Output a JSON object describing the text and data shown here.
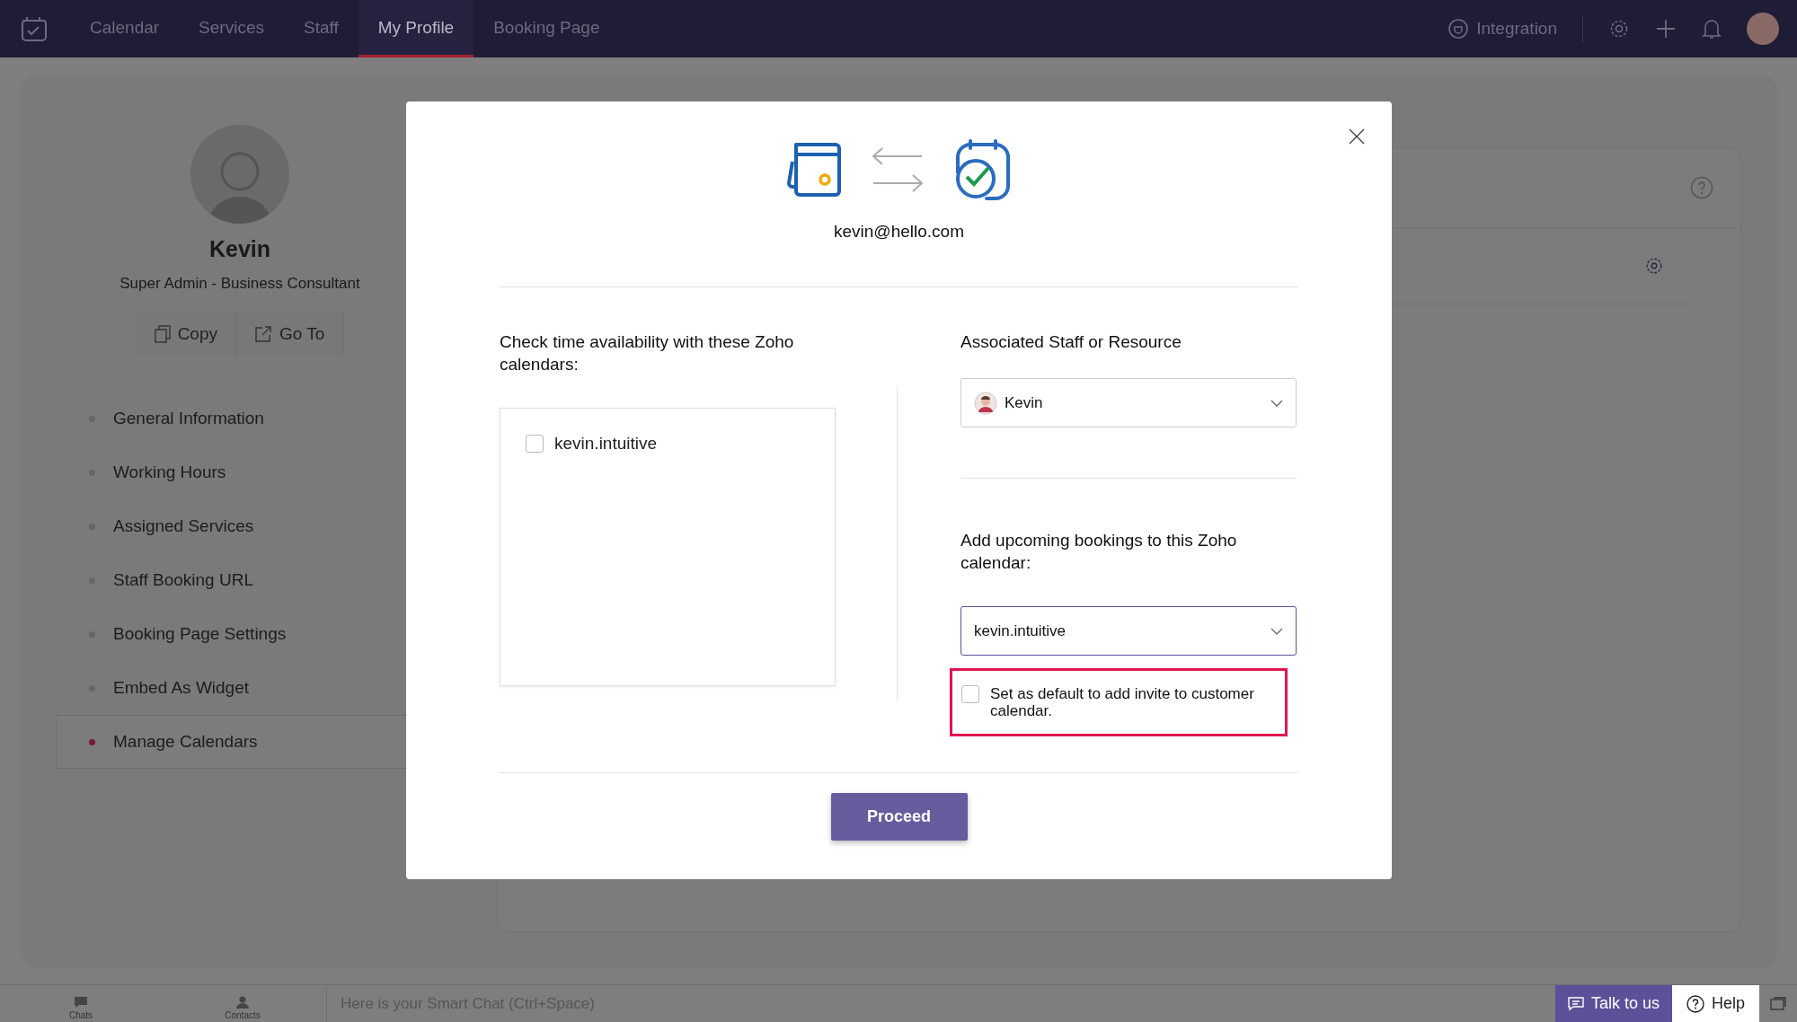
{
  "nav": {
    "tabs": [
      {
        "label": "Calendar",
        "selected": false
      },
      {
        "label": "Services",
        "selected": false
      },
      {
        "label": "Staff",
        "selected": false
      },
      {
        "label": "My Profile",
        "selected": true
      },
      {
        "label": "Booking Page",
        "selected": false
      }
    ],
    "integration": "Integration"
  },
  "profile": {
    "name": "Kevin",
    "role": "Super Admin - Business Consultant",
    "actions": [
      "Copy",
      "Go To"
    ],
    "menu": [
      {
        "label": "General Information",
        "selected": false
      },
      {
        "label": "Working Hours",
        "selected": false
      },
      {
        "label": "Assigned Services",
        "selected": false
      },
      {
        "label": "Staff Booking URL",
        "selected": false
      },
      {
        "label": "Booking Page Settings",
        "selected": false
      },
      {
        "label": "Embed As Widget",
        "selected": false
      },
      {
        "label": "Manage Calendars",
        "selected": true
      }
    ]
  },
  "modal": {
    "email": "kevin@hello.com",
    "availability_heading": "Check time availability with these Zoho calendars:",
    "calendars": [
      {
        "label": "kevin.intuitive",
        "checked": false
      }
    ],
    "staff_heading": "Associated Staff or Resource",
    "staff_select": "Kevin",
    "bookings_heading": "Add upcoming bookings to this Zoho calendar:",
    "bookings_select": "kevin.intuitive",
    "default_option": {
      "label": "Set as default to add invite to customer calendar.",
      "checked": false
    },
    "proceed": "Proceed"
  },
  "bottom_bar": {
    "chats": "Chats",
    "contacts": "Contacts",
    "smart_chat": "Here is your Smart Chat (Ctrl+Space)",
    "talk": "Talk to us",
    "help": "Help"
  }
}
